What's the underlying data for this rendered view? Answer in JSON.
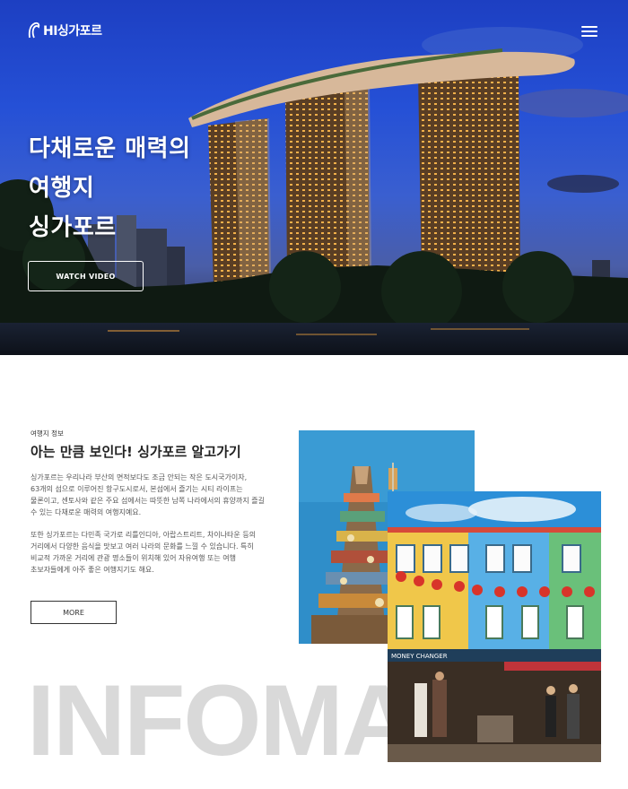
{
  "header": {
    "logo_text": "HI싱가포르",
    "logo_icon": "wave-logo-icon",
    "menu_icon": "hamburger-menu-icon"
  },
  "hero": {
    "title_lines": [
      "다채로운 매력의",
      "여행지",
      "싱가포르"
    ],
    "watch_label": "WATCH VIDEO"
  },
  "info": {
    "eyebrow": "여행지 정보",
    "heading": "아는 만큼 보인다! 싱가포르 알고가기",
    "paragraph1": "싱가포르는 우리나라 부산의 면적보다도 조금 안되는 작은 도시국가이자, 63개의 섬으로 이루어진 항구도시로서, 본섬에서 즐기는 시티 라이프는 물론이고, 센토사와 같은 주요 섬에서는 따뜻한 남쪽 나라에서의 휴양까지 즐길 수 있는 다채로운 매력의 여행지예요.",
    "paragraph2": "또한 싱가포르는 다민족 국가로 리틀인디아, 아랍스트리트, 차이나타운 등의 거리에서 다양한 음식을 맛보고 여러 나라의 문화를 느낄 수 있습니다. 특히 비교적 가까운 거리에 관광 명소들이 위치해 있어 자유여행 또는 여행 초보자들에게 아주 좋은 여행지기도 해요.",
    "more_label": "MORE",
    "watermark": "INFOMA"
  },
  "photos": {
    "sign_text": "MONEY CHANGER"
  },
  "colors": {
    "sky": "#2550d6",
    "building_lights": "#f2b04a",
    "watermark": "#d9d9d9"
  }
}
